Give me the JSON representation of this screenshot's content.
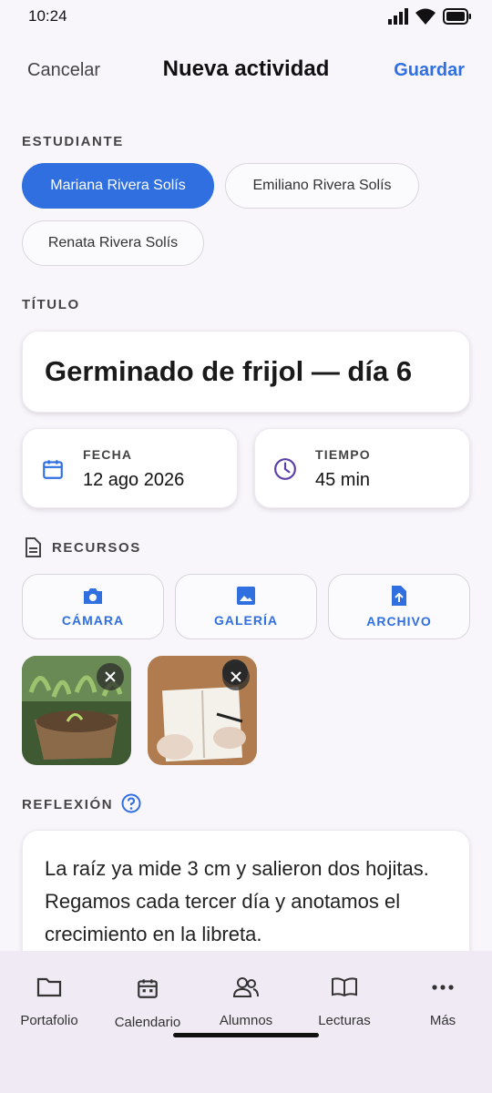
{
  "status": {
    "time": "10:24"
  },
  "header": {
    "cancel": "Cancelar",
    "title": "Nueva actividad",
    "save": "Guardar"
  },
  "student": {
    "label": "ESTUDIANTE",
    "options": [
      "Mariana Rivera Solís",
      "Emiliano Rivera Solís",
      "Renata Rivera Solís"
    ],
    "selected": "Mariana Rivera Solís"
  },
  "titulo": {
    "label": "TÍTULO",
    "value": "Germinado de frijol — día 6"
  },
  "fecha": {
    "label": "FECHA",
    "value": "12 ago 2026"
  },
  "tiempo": {
    "label": "TIEMPO",
    "value": "45 min"
  },
  "recursos": {
    "label": "RECURSOS",
    "buttons": {
      "camera": "CÁMARA",
      "gallery": "GALERÍA",
      "file": "ARCHIVO"
    }
  },
  "reflexion": {
    "label": "REFLEXIÓN",
    "text": "La raíz ya mide 3 cm y salieron dos hojitas. Regamos cada tercer día y anotamos el crecimiento en la libreta."
  },
  "nav": {
    "items": [
      "Portafolio",
      "Calendario",
      "Alumnos",
      "Lecturas",
      "Más"
    ]
  },
  "colors": {
    "accent": "#2f6fe0",
    "clock": "#5b3ea6"
  }
}
